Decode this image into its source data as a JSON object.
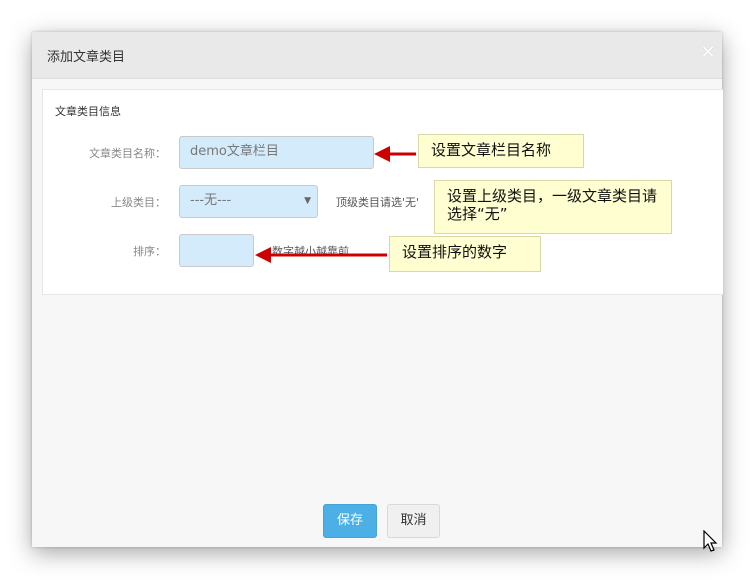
{
  "dialog": {
    "title": "添加文章类目",
    "close_icon": "close-icon"
  },
  "panel": {
    "title": "文章类目信息"
  },
  "form": {
    "name_label": "文章类目名称：",
    "name_value": "demo文章栏目",
    "parent_label": "上级类目：",
    "parent_selected": "---无---",
    "parent_hint": "顶级类目请选'无'",
    "order_label": "排序：",
    "order_value": "",
    "order_hint": "数字越小越靠前"
  },
  "callouts": {
    "name": "设置文章栏目名称",
    "parent": "设置上级类目，一级文章类目请选择“无”",
    "order": "设置排序的数字"
  },
  "buttons": {
    "save": "保存",
    "cancel": "取消"
  },
  "colors": {
    "primary": "#4cb0e6",
    "input_bg": "#d4ebfb",
    "callout_bg": "#fefed0",
    "arrow": "#cc0000"
  }
}
